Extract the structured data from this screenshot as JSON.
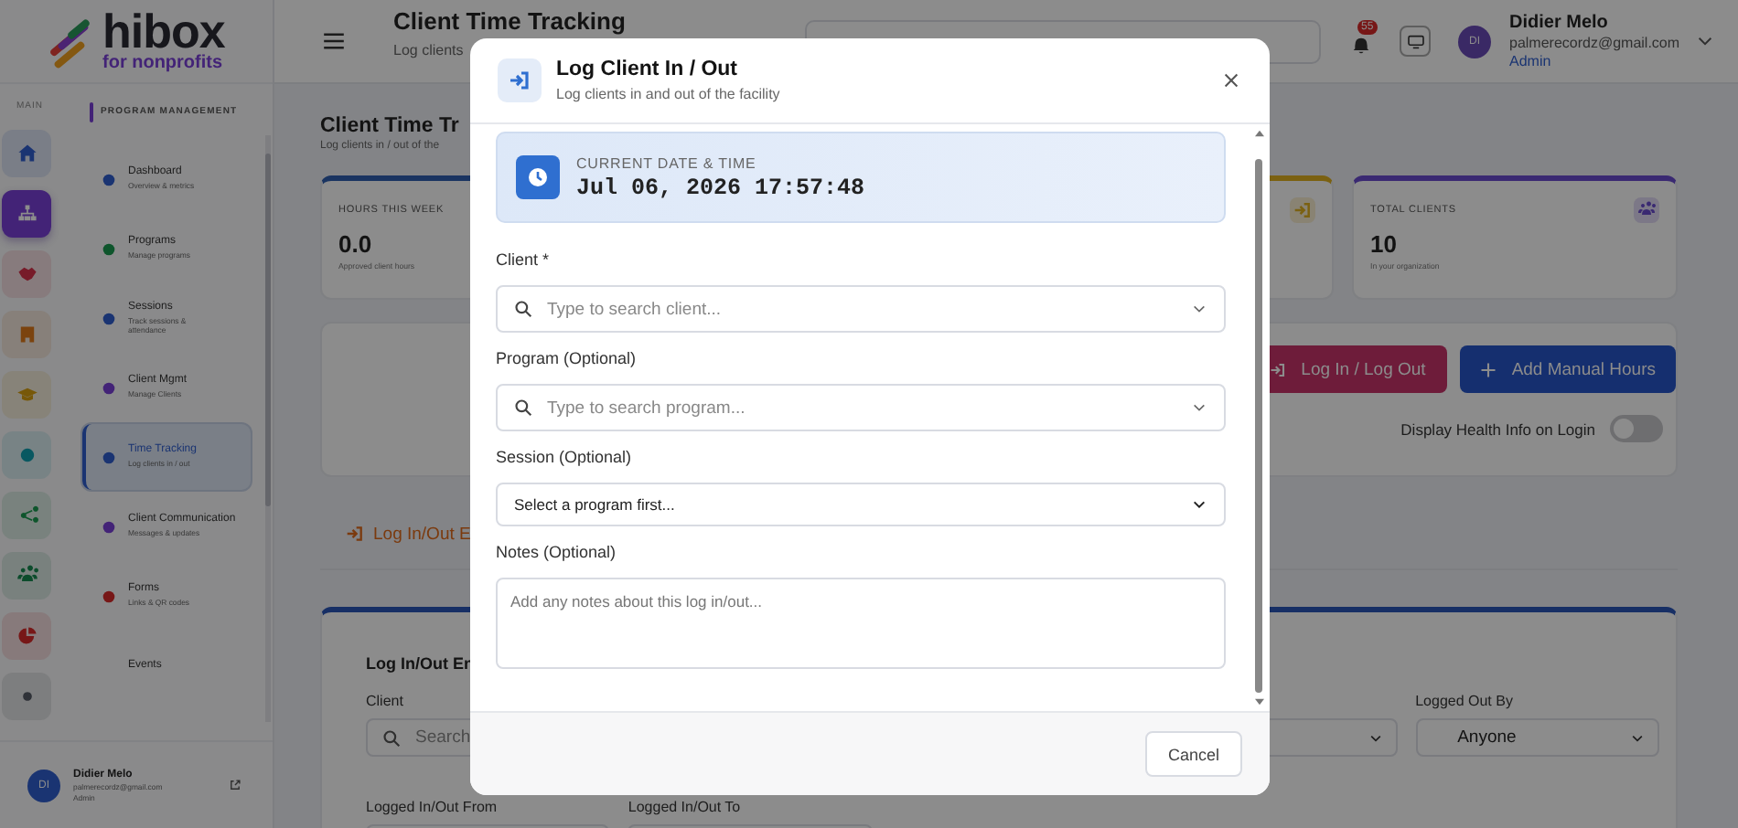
{
  "sidebar": {
    "logo": {
      "name": "hibox",
      "tagline": "for nonprofits"
    },
    "rail_label": "MAIN",
    "rail": [
      {
        "color": "#1a3472",
        "selected": false
      },
      {
        "color": "#432377",
        "selected": true
      },
      {
        "color": "#771b29",
        "selected": false
      },
      {
        "color": "#7b430e",
        "selected": false
      },
      {
        "color": "#775809",
        "selected": false
      },
      {
        "color": "#095861",
        "selected": false
      },
      {
        "color": "#0e552c",
        "selected": false
      },
      {
        "color": "#0c4c2c",
        "selected": false
      },
      {
        "color": "#771717",
        "selected": false
      },
      {
        "color": "#2f3238",
        "selected": false
      }
    ],
    "section_label": "PROGRAM MANAGEMENT",
    "nav": [
      {
        "title": "Dashboard",
        "subtitle": "Overview & metrics",
        "color": "#1a3472",
        "selected": false
      },
      {
        "title": "Programs",
        "subtitle": "Manage programs",
        "color": "#0e552c",
        "selected": false
      },
      {
        "title": "Sessions",
        "subtitle": "Track sessions & attendance",
        "color": "#1a3472",
        "selected": false
      },
      {
        "title": "Client Mgmt",
        "subtitle": "Manage Clients",
        "color": "#432377",
        "selected": false
      },
      {
        "title": "Time Tracking",
        "subtitle": "Log clients in / out",
        "color": "#1a3472",
        "selected": true
      },
      {
        "title": "Client Communication",
        "subtitle": "Messages & updates",
        "color": "#432377",
        "selected": false
      },
      {
        "title": "Forms",
        "subtitle": "Links & QR codes",
        "color": "#771717",
        "selected": false
      },
      {
        "title": "Events",
        "selected": false
      }
    ],
    "user": {
      "initials": "DI",
      "name": "Didier Melo",
      "email": "palmerecordz@gmail.com",
      "role": "Admin"
    }
  },
  "header": {
    "title": "Client Time Tracking",
    "subtitle": "Log clients",
    "notification_count": "55",
    "user": {
      "initials": "DI",
      "name": "Didier Melo",
      "email": "palmerecordz@gmail.com",
      "role": "Admin"
    }
  },
  "page": {
    "title": "Client Time Tr",
    "subtitle": "Log clients in / out of the"
  },
  "stats": [
    {
      "label": "HOURS THIS WEEK",
      "value": "0.0",
      "note": "Approved client hours",
      "color": "#1a3461"
    },
    {
      "color": "#7b6111"
    },
    {
      "label": "TOTAL CLIENTS",
      "value": "10",
      "note": "In your organization",
      "color": "#3a2972"
    }
  ],
  "actions": {
    "buttons": [
      {
        "label": "Log In / Log Out",
        "kind": "login"
      },
      {
        "label": "Add Manual Hours",
        "kind": "add"
      }
    ],
    "toggle": {
      "label": "Display Health Info on Login",
      "on": false
    }
  },
  "tabs": [
    {
      "label": "Log In/Out E",
      "selected": true
    }
  ],
  "filters": {
    "title": "Log In/Out En",
    "rows": [
      [
        {
          "kind": "search",
          "label": "Client",
          "placeholder": "Search"
        },
        {
          "kind": "select"
        },
        {
          "kind": "select",
          "label": "Logged Out By",
          "value": "Anyone"
        }
      ],
      [
        {
          "kind": "date",
          "label": "Logged In/Out From"
        },
        {
          "kind": "date",
          "label": "Logged In/Out To"
        }
      ]
    ]
  },
  "modal": {
    "title": "Log Client In / Out",
    "subtitle": "Log clients in and out of the facility",
    "datetime": {
      "label": "CURRENT DATE & TIME",
      "value": "Jul 06, 2026 17:57:48"
    },
    "fields": [
      {
        "kind": "search",
        "label": "Client *",
        "placeholder": "Type to search client..."
      },
      {
        "kind": "search",
        "label": "Program (Optional)",
        "placeholder": "Type to search program..."
      },
      {
        "kind": "select",
        "label": "Session (Optional)",
        "value": "Select a program first..."
      },
      {
        "kind": "textarea",
        "label": "Notes (Optional)",
        "placeholder": "Add any notes about this log in/out..."
      }
    ],
    "buttons": [
      "Cancel"
    ]
  }
}
